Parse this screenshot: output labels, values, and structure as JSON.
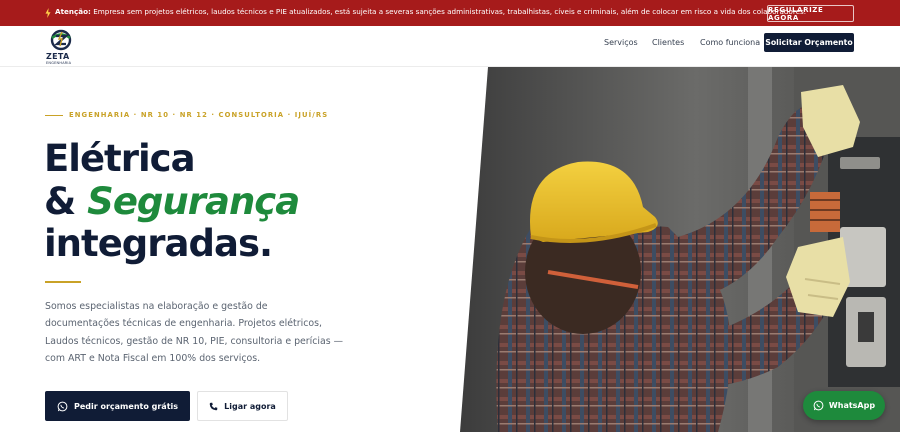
{
  "alert": {
    "lead": "Atenção:",
    "text": "Empresa sem projetos elétricos, laudos técnicos e PIE atualizados, está sujeita a severas sanções administrativas, trabalhistas, cíveis e criminais, além de colocar em risco a vida dos colaboradores.",
    "button": "REGULARIZE AGORA",
    "color": "#a61b1b"
  },
  "header": {
    "logo_name": "ZETA",
    "logo_sub": "ENGENHARIA",
    "nav": [
      "Serviços",
      "Clientes",
      "Como funciona"
    ],
    "cta": "Solicitar Orçamento"
  },
  "hero": {
    "kicker": "ENGENHARIA · NR 10 · NR 12 · CONSULTORIA · IJUÍ/RS",
    "title_line1": "Elétrica",
    "title_amp": "&",
    "title_highlight": "Segurança",
    "title_line3": "integradas.",
    "description": "Somos especialistas na elaboração e gestão de documentações técnicas de engenharia. Projetos elétricos, Laudos técnicos, gestão de NR 10, PIE, consultoria e perícias — com ART e Nota Fiscal em 100% dos serviços.",
    "primary_button": "Pedir orçamento grátis",
    "secondary_button": "Ligar agora"
  },
  "whatsapp": {
    "label": "WhatsApp"
  },
  "colors": {
    "navy": "#101c36",
    "green": "#1e8a3c",
    "gold": "#c9a227"
  }
}
